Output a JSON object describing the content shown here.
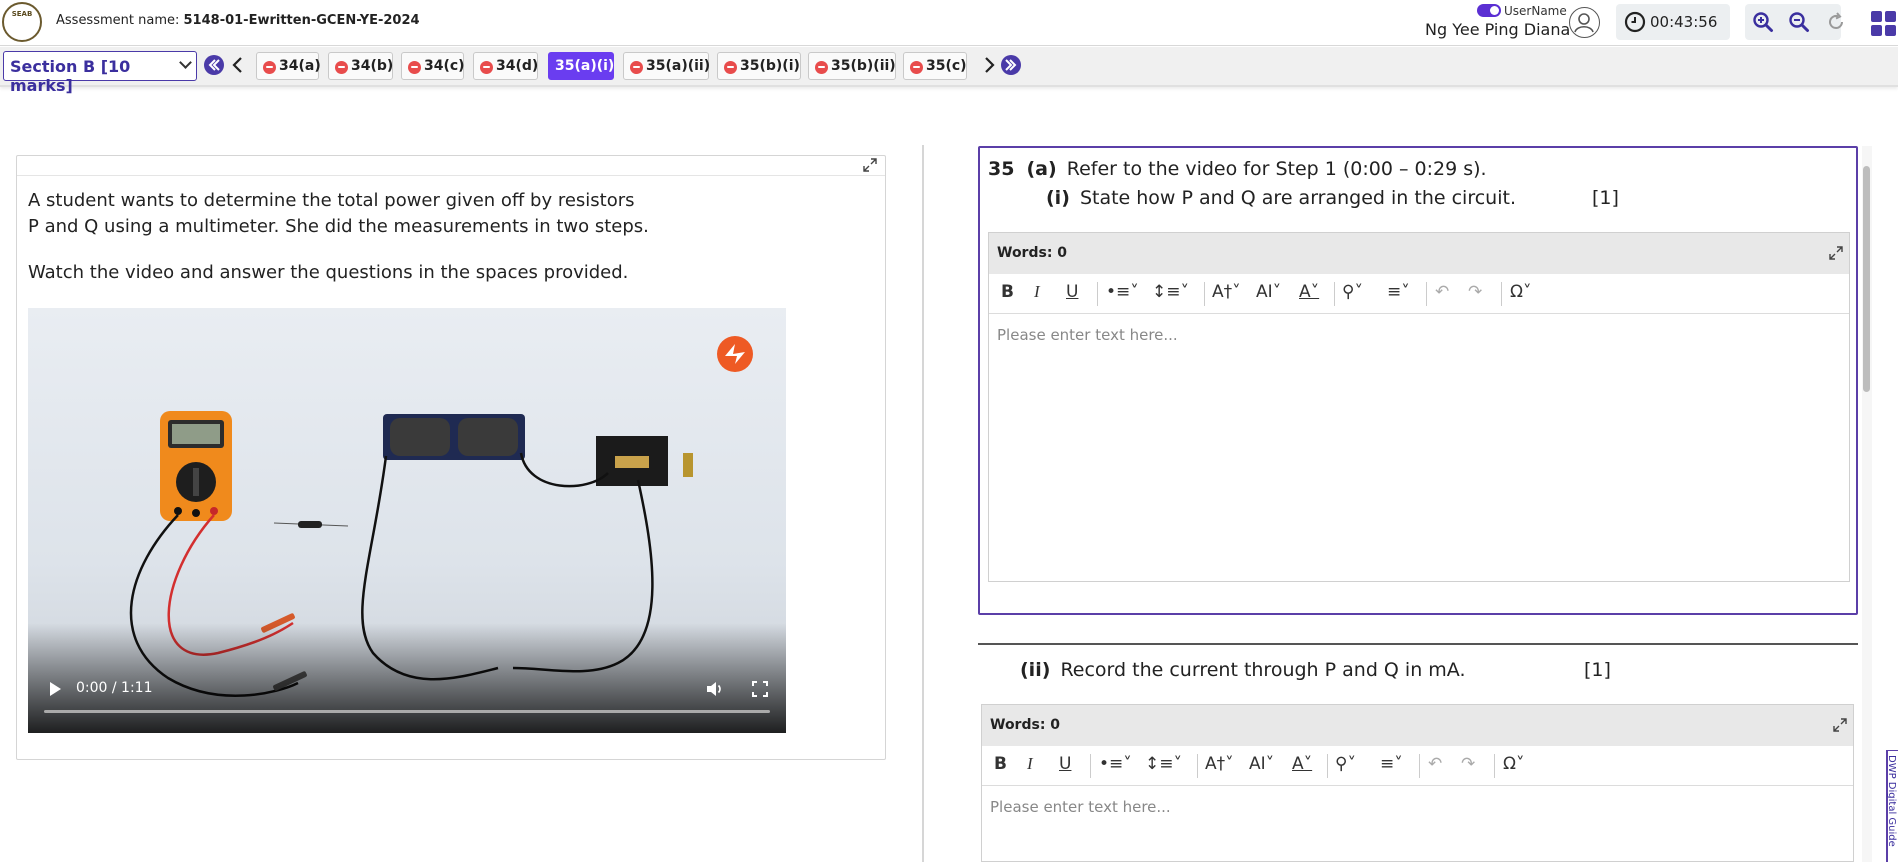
{
  "header": {
    "logo_text": "SEAB",
    "assessment_label": "Assessment name:",
    "assessment_name": "5148-01-Ewritten-GCEN-YE-2024",
    "username_label": "UserName",
    "username": "Ng Yee Ping Diana",
    "timer": "00:43:56"
  },
  "nav": {
    "section": "Section B [10 marks]",
    "tabs": [
      {
        "label": "34(a)",
        "active": false
      },
      {
        "label": "34(b)",
        "active": false
      },
      {
        "label": "34(c)",
        "active": false
      },
      {
        "label": "34(d)",
        "active": false
      },
      {
        "label": "35(a)(i)",
        "active": true
      },
      {
        "label": "35(a)(ii)",
        "active": false
      },
      {
        "label": "35(b)(i)",
        "active": false
      },
      {
        "label": "35(b)(ii)",
        "active": false
      },
      {
        "label": "35(c)",
        "active": false
      }
    ]
  },
  "source": {
    "para1_line1": "A student wants to determine the total power given off by resistors",
    "para1_line2": "P and Q using a multimeter. She did the measurements in two steps.",
    "para2": "Watch the video and answer the questions in the spaces provided.",
    "video_time": "0:00 / 1:11"
  },
  "q35a": {
    "number": "35",
    "part": "(a)",
    "stem": "Refer to the video for Step 1 (0:00 – 0:29 s).",
    "sub_i_label": "(i)",
    "sub_i_text": "State how P and Q are arranged in the circuit.",
    "sub_i_marks": "[1]",
    "sub_ii_label": "(ii)",
    "sub_ii_text": "Record the current through P and Q in mA.",
    "sub_ii_marks": "[1]"
  },
  "editor": {
    "words": "Words: 0",
    "placeholder": "Please enter text here...",
    "bold": "B",
    "italic": "I",
    "underline": "U",
    "special": "Ω"
  },
  "side_tab": "DWP Digital Guide"
}
